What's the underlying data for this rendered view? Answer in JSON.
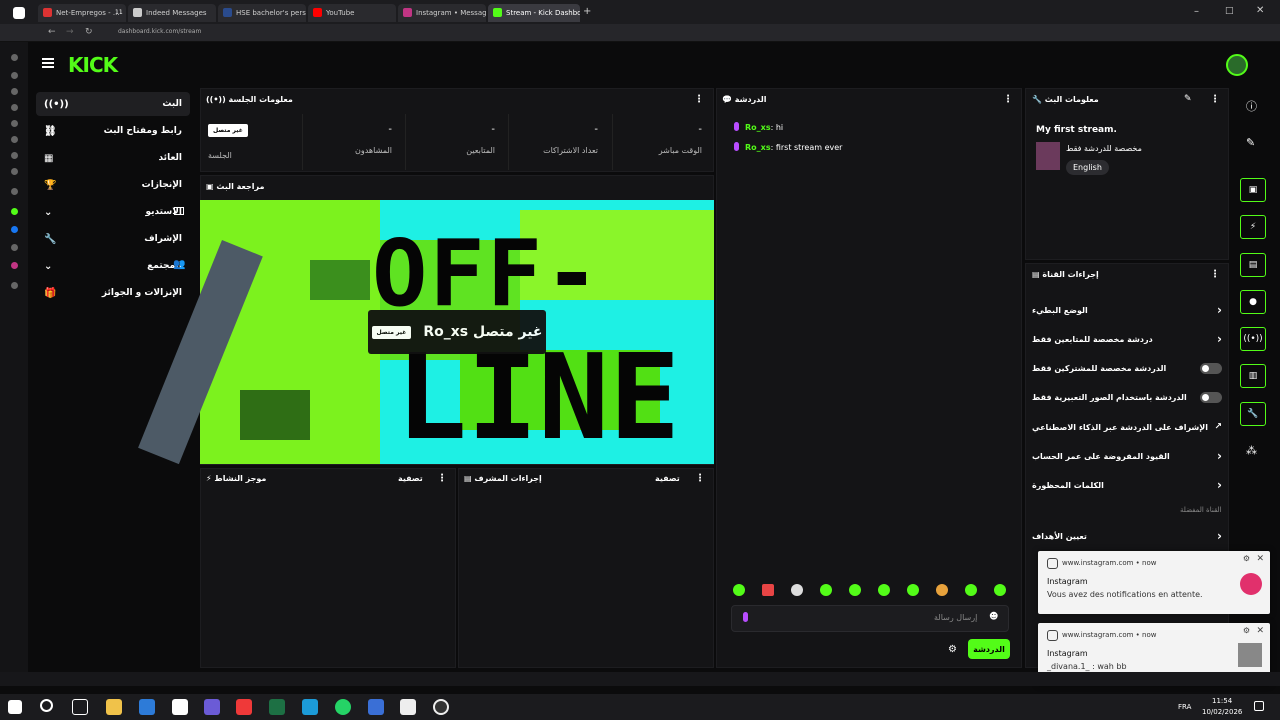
{
  "browser": {
    "tabs": [
      {
        "label": "Net-Empregos - ..."
      },
      {
        "label": "Indeed Messages"
      },
      {
        "label": "HSE bachelor's personal a..."
      },
      {
        "label": "YouTube"
      },
      {
        "label": "Instagram • Messages"
      },
      {
        "label": "Stream - Kick Dashboard"
      }
    ],
    "tab_counter": "11",
    "url": "dashboard.kick.com/stream"
  },
  "kick": {
    "logo": "KICK",
    "nav": [
      {
        "label": "البث",
        "icon": "live-icon"
      },
      {
        "label": "رابط ومفتاح البث",
        "icon": "link-icon"
      },
      {
        "label": "العائد",
        "icon": "chart-icon"
      },
      {
        "label": "الإنجازات",
        "icon": "trophy-icon"
      },
      {
        "label": "الاستديو",
        "icon": "studio-icon"
      },
      {
        "label": "الإشراف",
        "icon": "wrench-icon"
      },
      {
        "label": "المجتمع",
        "icon": "community-icon"
      },
      {
        "label": "الإنزالات و الجوائز",
        "icon": "gift-icon"
      }
    ],
    "session": {
      "title": "معلومات الجلسة",
      "badge": "غير متصل",
      "badge_caption": "الجلسة",
      "stats": [
        {
          "value": "-",
          "label": "المشاهدون"
        },
        {
          "value": "-",
          "label": "المتابعين"
        },
        {
          "value": "-",
          "label": "تعداد الاشتراكات"
        },
        {
          "value": "-",
          "label": "الوقت مباشر"
        }
      ]
    },
    "preview": {
      "title": "مراجعة البث",
      "offline_word_1": "OFF-",
      "offline_word_2": "LINE",
      "overlay_badge": "غير متصل",
      "overlay_name": "Ro_xs غير متصل"
    },
    "activity": {
      "title": "موجز النشاط",
      "filter": "تصفية"
    },
    "modactions": {
      "title": "إجراءات المشرف",
      "filter": "تصفية"
    },
    "chat": {
      "title": "الدردشة",
      "messages": [
        {
          "user": "Ro_xs",
          "text": ": hi"
        },
        {
          "user": "Ro_xs",
          "text": ": first stream ever"
        }
      ],
      "placeholder": "إرسال رسالة",
      "send": "الدردشة"
    },
    "stream_info": {
      "title": "معلومات البث",
      "stream_title": "My first stream.",
      "category": "مخصصة للدردشة فقط",
      "language": "English"
    },
    "channel_actions": {
      "title": "إجراءات القناة",
      "rows": [
        {
          "label": "الوضع البطيء",
          "control": "chevron"
        },
        {
          "label": "دردشة مخصصة للمتابعين فقط",
          "control": "chevron"
        },
        {
          "label": "الدردشة مخصصة للمشتركين فقط",
          "control": "toggle"
        },
        {
          "label": "الدردشة باستخدام الصور التعبيرية فقط",
          "control": "toggle"
        },
        {
          "label": "الإشراف على الدردشة عبر الذكاء الاصطناعي",
          "control": "external"
        },
        {
          "label": "القيود المفروضة على عمر الحساب",
          "control": "chevron"
        },
        {
          "label": "الكلمات المحظورة",
          "control": "chevron"
        }
      ],
      "section_label": "القناة المفضلة",
      "goals": "تعيين الأهداف"
    }
  },
  "notifications": [
    {
      "source": "www.instagram.com • now",
      "title": "Instagram",
      "message": "Vous avez des notifications en attente."
    },
    {
      "source": "www.instagram.com • now",
      "title": "Instagram",
      "message": "_divana.1_ : wah bb"
    }
  ],
  "taskbar": {
    "lang": "FRA",
    "time": "11:54",
    "date": "10/02/2026"
  },
  "colors": {
    "accent": "#53fc18",
    "background": "#0b0b0c",
    "panel": "#141416"
  }
}
